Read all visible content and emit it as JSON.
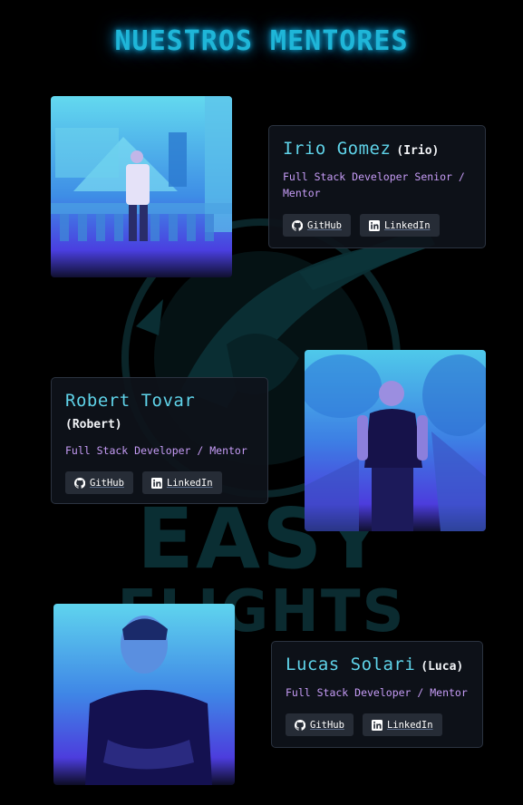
{
  "page": {
    "title": "NUESTROS MENTORES"
  },
  "watermark": {
    "line1": "EASY",
    "line2": "FLIGHTS"
  },
  "mentors": [
    {
      "name": "Irio Gomez",
      "nickname": "(Irio)",
      "role": "Full Stack Developer Senior / Mentor",
      "github_label": "GitHub",
      "linkedin_label": "LinkedIn"
    },
    {
      "name": "Robert Tovar",
      "nickname": "(Robert)",
      "role": "Full Stack Developer / Mentor",
      "github_label": "GitHub",
      "linkedin_label": "LinkedIn"
    },
    {
      "name": "Lucas Solari",
      "nickname": "(Luca)",
      "role": "Full Stack Developer / Mentor",
      "github_label": "GitHub",
      "linkedin_label": "LinkedIn"
    }
  ],
  "colors": {
    "title": "#1fb6d8",
    "name": "#5fd3e9",
    "role": "#c69cf6",
    "card_bg": "#0e121a",
    "button_bg": "#262c36"
  },
  "icons": [
    "github-icon",
    "linkedin-icon"
  ]
}
